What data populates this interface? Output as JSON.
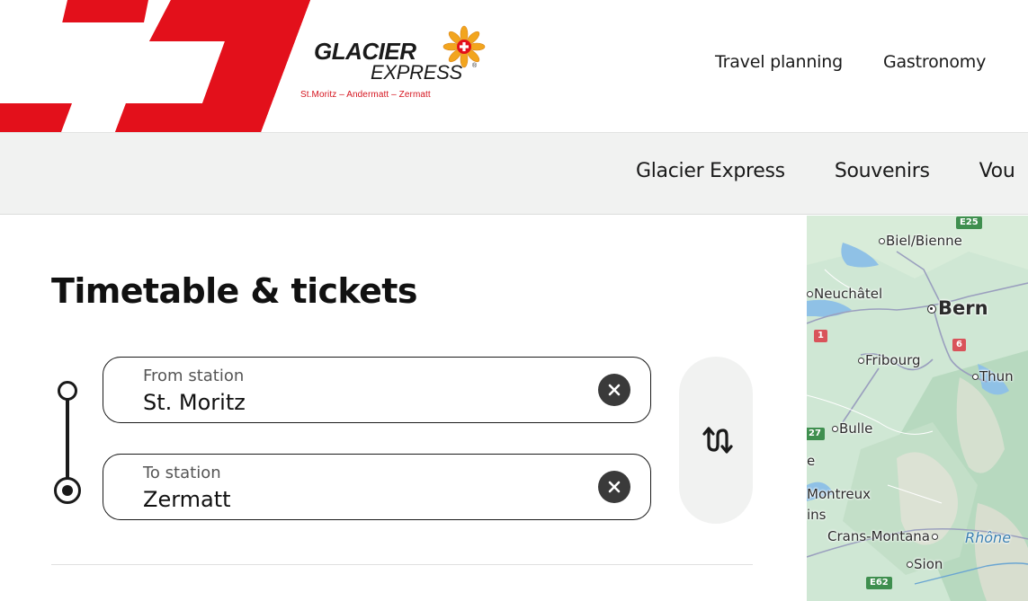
{
  "brand": {
    "name_line1": "GLACIER",
    "name_line2": "EXPRESS",
    "registered_mark": "®",
    "tagline": "St.Moritz – Andermatt – Zermatt",
    "accent_color": "#d5151f"
  },
  "top_nav": {
    "items": [
      {
        "label": "Travel planning"
      },
      {
        "label": "Gastronomy"
      }
    ]
  },
  "sub_nav": {
    "items": [
      {
        "label": "Glacier Express"
      },
      {
        "label": "Souvenirs"
      },
      {
        "label": "Vou"
      }
    ]
  },
  "main": {
    "title": "Timetable & tickets",
    "from": {
      "label": "From station",
      "value": "St. Moritz",
      "clear_icon": "close-icon"
    },
    "to": {
      "label": "To station",
      "value": "Zermatt",
      "clear_icon": "close-icon"
    },
    "swap_icon": "swap-direction-icon"
  },
  "map": {
    "cities": [
      {
        "name": "Biel/Bienne"
      },
      {
        "name": "Neuchâtel"
      },
      {
        "name": "Bern"
      },
      {
        "name": "Fribourg"
      },
      {
        "name": "Thun"
      },
      {
        "name": "Bulle"
      },
      {
        "name": "Montreux"
      },
      {
        "name": "Crans-Montana"
      },
      {
        "name": "Sion"
      }
    ],
    "partial_labels": [
      {
        "text": "e"
      },
      {
        "text": "ins"
      }
    ],
    "river": "Rhône",
    "roads": [
      {
        "ref": "E25",
        "kind": "green"
      },
      {
        "ref": "1",
        "kind": "red"
      },
      {
        "ref": "6",
        "kind": "red"
      },
      {
        "ref": "27",
        "kind": "green"
      },
      {
        "ref": "E62",
        "kind": "green"
      }
    ]
  }
}
